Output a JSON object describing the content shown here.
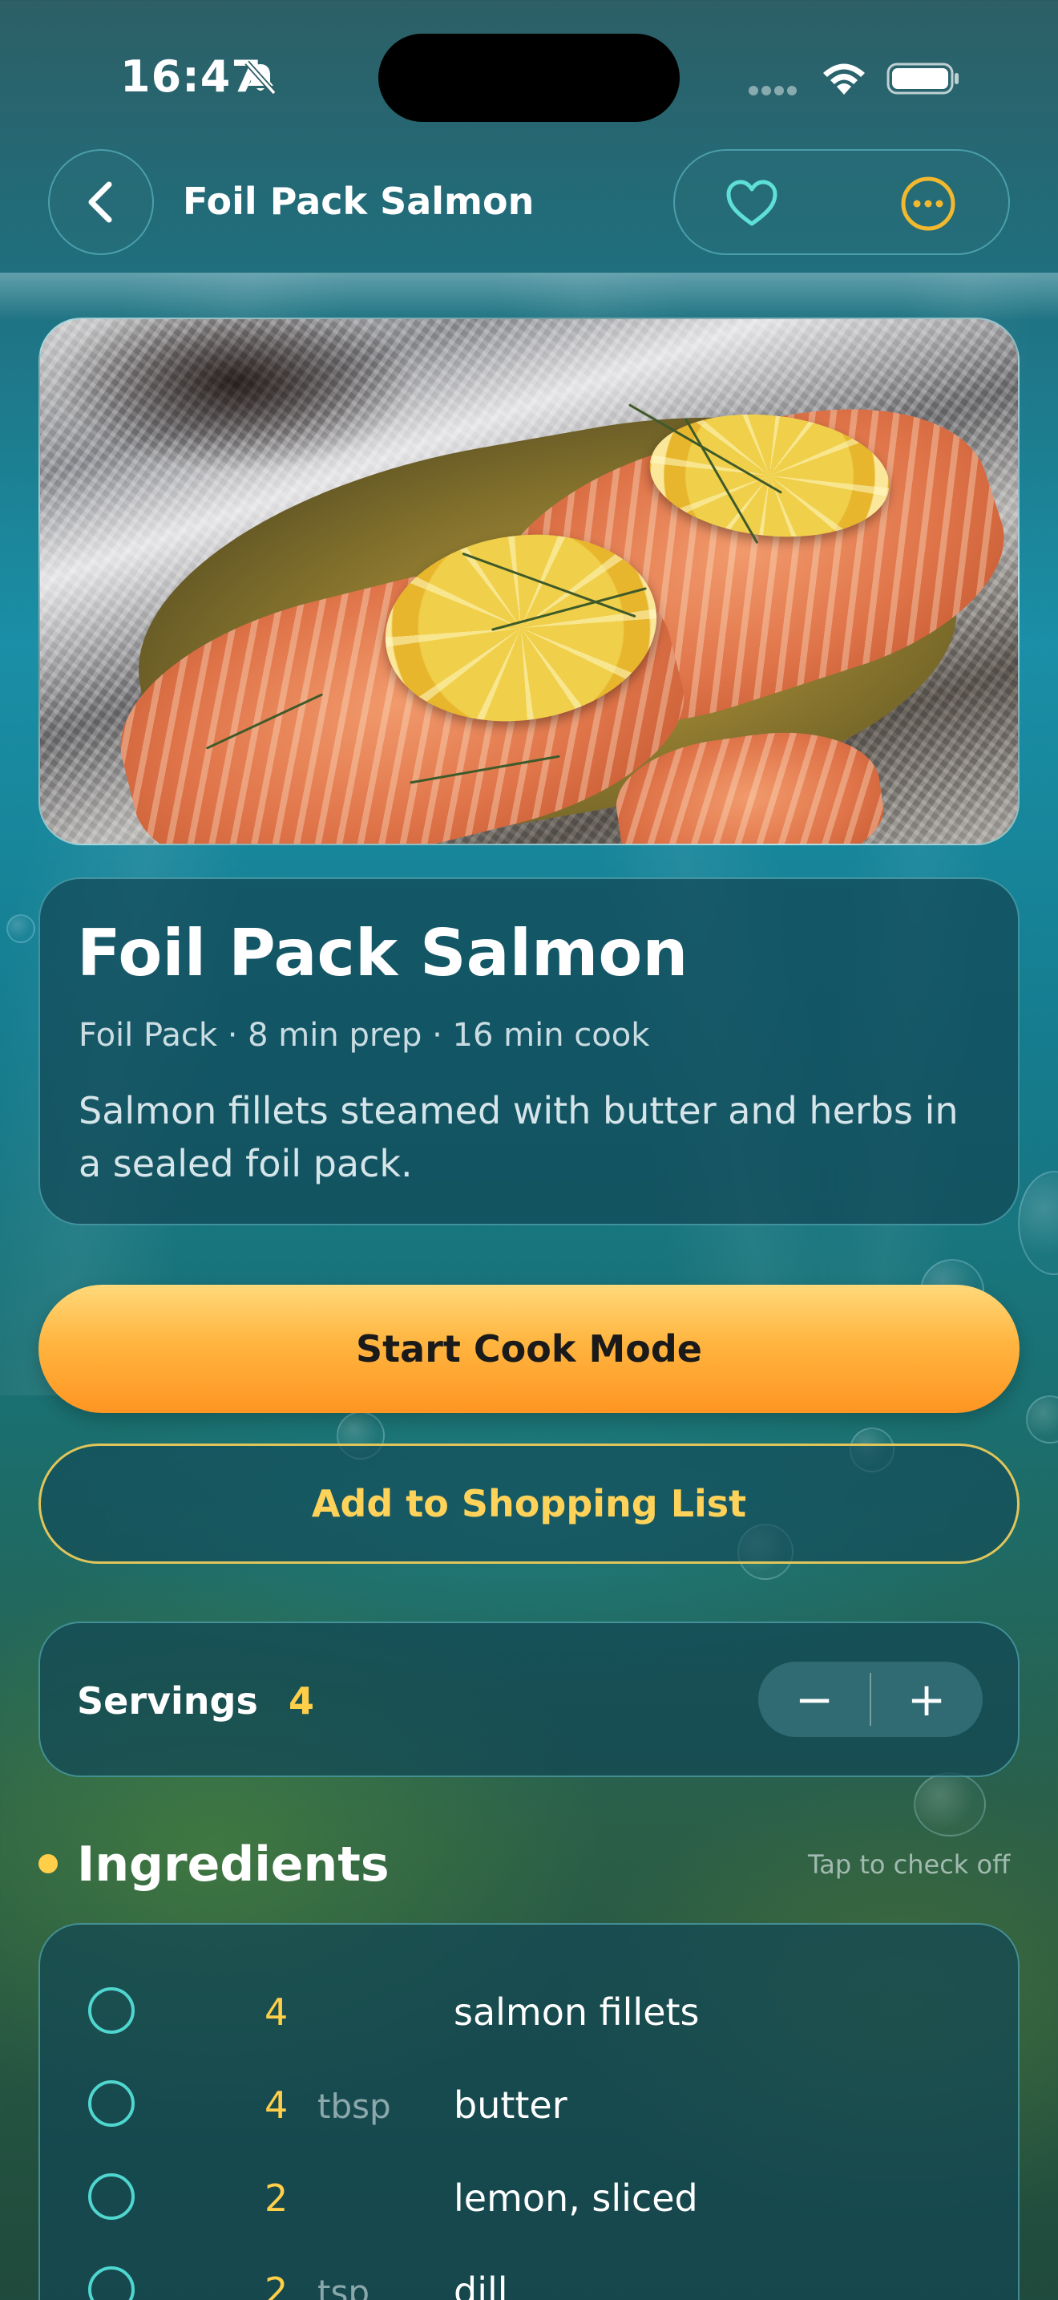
{
  "status_bar": {
    "time": "16:47"
  },
  "nav": {
    "title": "Foil Pack Salmon"
  },
  "recipe": {
    "title": "Foil Pack Salmon",
    "meta": "Foil Pack · 8 min prep · 16 min cook",
    "description": "Salmon fillets steamed with butter and herbs in a sealed foil pack."
  },
  "actions": {
    "start_cook": "Start Cook Mode",
    "add_shopping": "Add to Shopping List"
  },
  "servings": {
    "label": "Servings",
    "value": "4",
    "minus": "−",
    "plus": "+"
  },
  "ingredients": {
    "title": "Ingredients",
    "hint": "Tap to check off",
    "items": [
      {
        "qty": "4",
        "unit": "",
        "name": "salmon fillets"
      },
      {
        "qty": "4",
        "unit": "tbsp",
        "name": "butter"
      },
      {
        "qty": "2",
        "unit": "",
        "name": "lemon, sliced"
      },
      {
        "qty": "2",
        "unit": "tsp",
        "name": "dill"
      }
    ]
  },
  "colors": {
    "accent_gold": "#ffcf4a",
    "accent_teal": "#4fd6cf",
    "cook_button": "#ffb540"
  }
}
